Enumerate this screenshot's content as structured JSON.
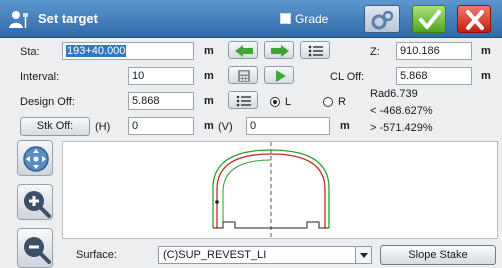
{
  "window": {
    "title": "Set target",
    "grade_label": "Grade",
    "grade_checked": false
  },
  "title_icons": {
    "app": "surveyor-icon",
    "settings": "settings-icon",
    "ok": "checkmark-icon",
    "close": "close-icon"
  },
  "sta": {
    "label": "Sta:",
    "value": "193+40.000",
    "unit": "m"
  },
  "interval": {
    "label": "Interval:",
    "value": "10",
    "unit": "m"
  },
  "design_off": {
    "label": "Design Off:",
    "value": "5.868",
    "unit": "m"
  },
  "stk_off": {
    "button_label": "Stk Off:",
    "h_label": "(H)",
    "h_value": "0",
    "h_unit": "m",
    "v_label": "(V)",
    "v_value": "0",
    "v_unit": "m"
  },
  "z": {
    "label": "Z:",
    "value": "910.186",
    "unit": "m"
  },
  "cl_off": {
    "label": "CL Off:",
    "value": "5.868",
    "unit": "m"
  },
  "side": {
    "left_label": "L",
    "right_label": "R",
    "selected": "L"
  },
  "info": {
    "rad": "Rad6.739",
    "lt": "< -468.627%",
    "gt": "> -571.429%"
  },
  "surface": {
    "label": "Surface:",
    "value": "(C)SUP_REVEST_LI"
  },
  "slope_stake_label": "Slope Stake",
  "colors": {
    "accent": "#2f6aa8",
    "arrow_green": "#3fa535",
    "section_red": "#c62828",
    "section_green": "#2e9e2e"
  }
}
